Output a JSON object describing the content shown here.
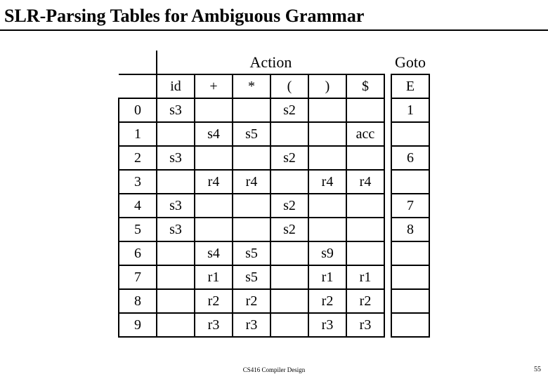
{
  "title": "SLR-Parsing Tables for Ambiguous Grammar",
  "section_labels": {
    "action": "Action",
    "goto": "Goto"
  },
  "columns": {
    "id": "id",
    "plus": "+",
    "star": "*",
    "lpar": "(",
    "rpar": ")",
    "dollar": "$",
    "E": "E"
  },
  "states": [
    "0",
    "1",
    "2",
    "3",
    "4",
    "5",
    "6",
    "7",
    "8",
    "9"
  ],
  "rows": [
    {
      "id": "s3",
      "plus": "",
      "star": "",
      "lpar": "s2",
      "rpar": "",
      "dollar": "",
      "E": "1"
    },
    {
      "id": "",
      "plus": "s4",
      "star": "s5",
      "lpar": "",
      "rpar": "",
      "dollar": "acc",
      "E": ""
    },
    {
      "id": "s3",
      "plus": "",
      "star": "",
      "lpar": "s2",
      "rpar": "",
      "dollar": "",
      "E": "6"
    },
    {
      "id": "",
      "plus": "r4",
      "star": "r4",
      "lpar": "",
      "rpar": "r4",
      "dollar": "r4",
      "E": ""
    },
    {
      "id": "s3",
      "plus": "",
      "star": "",
      "lpar": "s2",
      "rpar": "",
      "dollar": "",
      "E": "7"
    },
    {
      "id": "s3",
      "plus": "",
      "star": "",
      "lpar": "s2",
      "rpar": "",
      "dollar": "",
      "E": "8"
    },
    {
      "id": "",
      "plus": "s4",
      "star": "s5",
      "lpar": "",
      "rpar": "s9",
      "dollar": "",
      "E": ""
    },
    {
      "id": "",
      "plus": "r1",
      "star": "s5",
      "lpar": "",
      "rpar": "r1",
      "dollar": "r1",
      "E": ""
    },
    {
      "id": "",
      "plus": "r2",
      "star": "r2",
      "lpar": "",
      "rpar": "r2",
      "dollar": "r2",
      "E": ""
    },
    {
      "id": "",
      "plus": "r3",
      "star": "r3",
      "lpar": "",
      "rpar": "r3",
      "dollar": "r3",
      "E": ""
    }
  ],
  "footer": "CS416 Compiler Design",
  "pagenum": "55",
  "chart_data": {
    "type": "table",
    "title": "SLR-Parsing Tables for Ambiguous Grammar",
    "sections": [
      "Action",
      "Goto"
    ],
    "action_columns": [
      "id",
      "+",
      "*",
      "(",
      ")",
      "$"
    ],
    "goto_columns": [
      "E"
    ],
    "table": {
      "0": {
        "id": "s3",
        "(": "s2",
        "E": "1"
      },
      "1": {
        "+": "s4",
        "*": "s5",
        "$": "acc"
      },
      "2": {
        "id": "s3",
        "(": "s2",
        "E": "6"
      },
      "3": {
        "+": "r4",
        "*": "r4",
        ")": "r4",
        "$": "r4"
      },
      "4": {
        "id": "s3",
        "(": "s2",
        "E": "7"
      },
      "5": {
        "id": "s3",
        "(": "s2",
        "E": "8"
      },
      "6": {
        "+": "s4",
        "*": "s5",
        ")": "s9"
      },
      "7": {
        "+": "r1",
        "*": "s5",
        ")": "r1",
        "$": "r1"
      },
      "8": {
        "+": "r2",
        "*": "r2",
        ")": "r2",
        "$": "r2"
      },
      "9": {
        "+": "r3",
        "*": "r3",
        ")": "r3",
        "$": "r3"
      }
    }
  }
}
